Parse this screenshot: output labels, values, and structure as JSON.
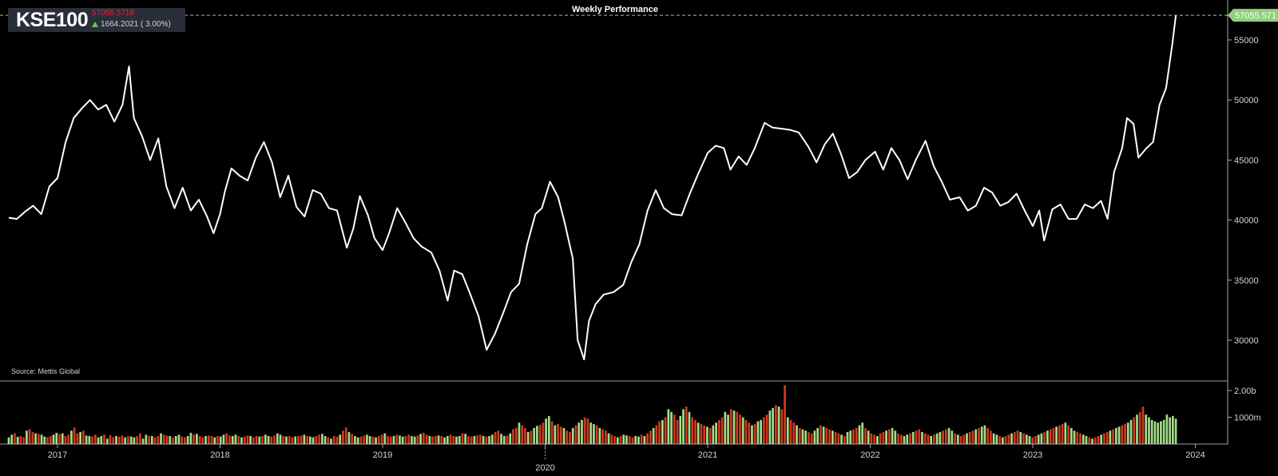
{
  "badge": {
    "symbol": "KSE100",
    "price": "57055.5719",
    "change": "1664.2021 ( 3.00%)",
    "direction_icon": "arrow-up-icon"
  },
  "chart_title": "Weekly Performance",
  "source": "Source: Mettis Global",
  "last_price_label": "57055.571",
  "colors": {
    "background": "#000000",
    "line": "#ffffff",
    "volume_up": "#a5dc8c",
    "volume_down": "#d13b1a",
    "price_tag": "#8fd07a",
    "price_text_red": "#e0263a",
    "axis_text": "#cfd3dc"
  },
  "chart_data": {
    "type": "line",
    "title": "Weekly Performance",
    "price_axis": {
      "ylim": [
        27000,
        58000
      ],
      "ticks": [
        30000,
        35000,
        40000,
        45000,
        50000,
        55000
      ],
      "tick_labels": [
        "30000",
        "35000",
        "40000",
        "45000",
        "50000",
        "55000"
      ]
    },
    "volume_axis": {
      "ylim": [
        0,
        2500
      ],
      "ticks": [
        1000,
        2000
      ],
      "tick_labels": [
        "1000m",
        "2.00b"
      ]
    },
    "x_axis": {
      "ticks": [
        2017,
        2018,
        2019,
        2020,
        2021,
        2022,
        2023,
        2024
      ],
      "tick_labels": [
        "2017",
        "2018",
        "2019",
        "2020",
        "2021",
        "2022",
        "2023",
        "2024"
      ],
      "range": [
        2016.7,
        2024.25
      ]
    },
    "price_anchors": [
      [
        2016.7,
        40200
      ],
      [
        2016.75,
        40100
      ],
      [
        2016.8,
        40700
      ],
      [
        2016.85,
        41200
      ],
      [
        2016.9,
        40500
      ],
      [
        2016.95,
        42800
      ],
      [
        2017.0,
        43500
      ],
      [
        2017.05,
        46500
      ],
      [
        2017.1,
        48500
      ],
      [
        2017.15,
        49300
      ],
      [
        2017.2,
        50000
      ],
      [
        2017.25,
        49200
      ],
      [
        2017.3,
        49600
      ],
      [
        2017.35,
        48200
      ],
      [
        2017.4,
        49600
      ],
      [
        2017.44,
        52800
      ],
      [
        2017.47,
        48500
      ],
      [
        2017.52,
        47000
      ],
      [
        2017.57,
        45000
      ],
      [
        2017.62,
        46800
      ],
      [
        2017.67,
        42800
      ],
      [
        2017.72,
        41000
      ],
      [
        2017.77,
        42700
      ],
      [
        2017.82,
        40800
      ],
      [
        2017.87,
        41700
      ],
      [
        2017.92,
        40300
      ],
      [
        2017.96,
        38900
      ],
      [
        2018.0,
        40500
      ],
      [
        2018.03,
        42400
      ],
      [
        2018.07,
        44300
      ],
      [
        2018.12,
        43700
      ],
      [
        2018.17,
        43300
      ],
      [
        2018.22,
        45200
      ],
      [
        2018.27,
        46500
      ],
      [
        2018.32,
        44800
      ],
      [
        2018.37,
        41900
      ],
      [
        2018.42,
        43700
      ],
      [
        2018.47,
        41100
      ],
      [
        2018.52,
        40300
      ],
      [
        2018.57,
        42500
      ],
      [
        2018.62,
        42200
      ],
      [
        2018.67,
        41000
      ],
      [
        2018.72,
        40800
      ],
      [
        2018.78,
        37700
      ],
      [
        2018.82,
        39300
      ],
      [
        2018.86,
        42000
      ],
      [
        2018.91,
        40400
      ],
      [
        2018.95,
        38500
      ],
      [
        2019.0,
        37500
      ],
      [
        2019.04,
        38900
      ],
      [
        2019.09,
        41000
      ],
      [
        2019.14,
        39800
      ],
      [
        2019.19,
        38500
      ],
      [
        2019.24,
        37800
      ],
      [
        2019.3,
        37300
      ],
      [
        2019.35,
        35800
      ],
      [
        2019.4,
        33300
      ],
      [
        2019.44,
        35800
      ],
      [
        2019.49,
        35500
      ],
      [
        2019.54,
        33800
      ],
      [
        2019.59,
        32000
      ],
      [
        2019.64,
        29200
      ],
      [
        2019.69,
        30500
      ],
      [
        2019.74,
        32200
      ],
      [
        2019.79,
        34000
      ],
      [
        2019.84,
        34700
      ],
      [
        2019.89,
        38000
      ],
      [
        2019.94,
        40500
      ],
      [
        2019.98,
        41000
      ],
      [
        2020.03,
        43200
      ],
      [
        2020.08,
        41900
      ],
      [
        2020.12,
        39800
      ],
      [
        2020.17,
        36800
      ],
      [
        2020.2,
        30000
      ],
      [
        2020.24,
        28400
      ],
      [
        2020.27,
        31600
      ],
      [
        2020.31,
        33000
      ],
      [
        2020.36,
        33800
      ],
      [
        2020.42,
        34000
      ],
      [
        2020.48,
        34600
      ],
      [
        2020.53,
        36500
      ],
      [
        2020.58,
        38000
      ],
      [
        2020.63,
        40800
      ],
      [
        2020.68,
        42500
      ],
      [
        2020.73,
        41000
      ],
      [
        2020.78,
        40500
      ],
      [
        2020.84,
        40400
      ],
      [
        2020.89,
        42200
      ],
      [
        2020.94,
        43800
      ],
      [
        2021.0,
        45600
      ],
      [
        2021.05,
        46200
      ],
      [
        2021.1,
        46000
      ],
      [
        2021.14,
        44200
      ],
      [
        2021.19,
        45300
      ],
      [
        2021.24,
        44600
      ],
      [
        2021.29,
        46000
      ],
      [
        2021.35,
        48100
      ],
      [
        2021.4,
        47700
      ],
      [
        2021.46,
        47600
      ],
      [
        2021.51,
        47500
      ],
      [
        2021.56,
        47300
      ],
      [
        2021.62,
        46100
      ],
      [
        2021.67,
        44800
      ],
      [
        2021.72,
        46300
      ],
      [
        2021.77,
        47200
      ],
      [
        2021.82,
        45500
      ],
      [
        2021.87,
        43500
      ],
      [
        2021.92,
        44000
      ],
      [
        2021.97,
        45000
      ],
      [
        2022.03,
        45700
      ],
      [
        2022.08,
        44200
      ],
      [
        2022.13,
        46000
      ],
      [
        2022.18,
        45000
      ],
      [
        2022.23,
        43400
      ],
      [
        2022.28,
        45000
      ],
      [
        2022.34,
        46600
      ],
      [
        2022.39,
        44500
      ],
      [
        2022.44,
        43200
      ],
      [
        2022.49,
        41700
      ],
      [
        2022.55,
        41900
      ],
      [
        2022.6,
        40800
      ],
      [
        2022.65,
        41200
      ],
      [
        2022.7,
        42700
      ],
      [
        2022.75,
        42300
      ],
      [
        2022.8,
        41200
      ],
      [
        2022.85,
        41500
      ],
      [
        2022.9,
        42200
      ],
      [
        2022.95,
        40800
      ],
      [
        2023.0,
        39500
      ],
      [
        2023.04,
        40800
      ],
      [
        2023.07,
        38300
      ],
      [
        2023.12,
        40900
      ],
      [
        2023.17,
        41300
      ],
      [
        2023.22,
        40100
      ],
      [
        2023.27,
        40100
      ],
      [
        2023.32,
        41300
      ],
      [
        2023.37,
        41000
      ],
      [
        2023.42,
        41600
      ],
      [
        2023.46,
        40100
      ],
      [
        2023.5,
        44000
      ],
      [
        2023.55,
        46000
      ],
      [
        2023.58,
        48500
      ],
      [
        2023.62,
        48000
      ],
      [
        2023.65,
        45200
      ],
      [
        2023.7,
        46000
      ],
      [
        2023.74,
        46500
      ],
      [
        2023.78,
        49600
      ],
      [
        2023.82,
        51000
      ],
      [
        2023.86,
        54800
      ],
      [
        2023.88,
        57055
      ]
    ],
    "volume_bars_m": [
      250,
      350,
      400,
      270,
      300,
      250,
      500,
      550,
      450,
      400,
      380,
      350,
      280,
      260,
      300,
      350,
      420,
      380,
      400,
      300,
      350,
      500,
      620,
      400,
      450,
      500,
      320,
      300,
      280,
      350,
      250,
      300,
      350,
      200,
      330,
      260,
      300,
      280,
      320,
      250,
      300,
      280,
      250,
      300,
      400,
      200,
      350,
      300,
      300,
      250,
      300,
      400,
      350,
      320,
      300,
      250,
      300,
      350,
      280,
      250,
      300,
      420,
      350,
      380,
      300,
      250,
      300,
      320,
      300,
      250,
      300,
      280,
      350,
      400,
      320,
      300,
      350,
      300,
      250,
      280,
      320,
      300,
      250,
      300,
      280,
      300,
      350,
      300,
      280,
      320,
      400,
      350,
      300,
      280,
      300,
      250,
      280,
      300,
      320,
      350,
      300,
      280,
      250,
      300,
      350,
      380,
      300,
      250,
      200,
      300,
      280,
      350,
      500,
      620,
      450,
      380,
      300,
      250,
      280,
      320,
      350,
      300,
      280,
      250,
      300,
      350,
      400,
      300,
      280,
      300,
      350,
      320,
      280,
      300,
      350,
      300,
      280,
      320,
      380,
      420,
      350,
      300,
      280,
      300,
      320,
      300,
      250,
      300,
      350,
      300,
      280,
      300,
      400,
      380,
      300,
      280,
      300,
      320,
      350,
      300,
      280,
      300,
      350,
      450,
      500,
      380,
      300,
      320,
      400,
      550,
      600,
      800,
      700,
      600,
      450,
      500,
      600,
      680,
      720,
      800,
      950,
      1050,
      850,
      700,
      750,
      650,
      600,
      500,
      450,
      600,
      700,
      800,
      900,
      1000,
      950,
      800,
      750,
      700,
      600,
      550,
      500,
      400,
      350,
      300,
      250,
      300,
      350,
      320,
      300,
      250,
      300,
      280,
      350,
      300,
      400,
      500,
      600,
      700,
      850,
      900,
      1000,
      1300,
      1200,
      1100,
      900,
      1050,
      1300,
      1400,
      1200,
      1000,
      900,
      800,
      750,
      700,
      650,
      600,
      700,
      800,
      900,
      1000,
      1200,
      1100,
      1300,
      1250,
      1200,
      1100,
      1000,
      900,
      800,
      700,
      750,
      850,
      900,
      1000,
      1100,
      1250,
      1350,
      1450,
      1400,
      1300,
      2200,
      1000,
      900,
      800,
      700,
      600,
      550,
      500,
      450,
      400,
      500,
      600,
      700,
      650,
      600,
      550,
      500,
      450,
      400,
      350,
      300,
      450,
      500,
      550,
      600,
      700,
      800,
      600,
      500,
      400,
      350,
      300,
      400,
      450,
      500,
      550,
      600,
      500,
      400,
      350,
      300,
      350,
      400,
      450,
      500,
      550,
      450,
      400,
      350,
      300,
      350,
      400,
      450,
      500,
      550,
      600,
      500,
      400,
      350,
      300,
      350,
      400,
      450,
      500,
      550,
      600,
      650,
      700,
      600,
      500,
      400,
      350,
      300,
      250,
      300,
      350,
      400,
      450,
      500,
      450,
      400,
      350,
      300,
      250,
      300,
      350,
      400,
      450,
      500,
      550,
      600,
      650,
      700,
      750,
      800,
      700,
      600,
      500,
      450,
      400,
      350,
      300,
      250,
      200,
      250,
      300,
      350,
      400,
      450,
      500,
      550,
      600,
      650,
      700,
      750,
      800,
      900,
      1000,
      1100,
      1200,
      1400,
      1100,
      1000,
      900,
      850,
      800,
      850,
      900,
      1100,
      1000,
      1050,
      950
    ]
  }
}
